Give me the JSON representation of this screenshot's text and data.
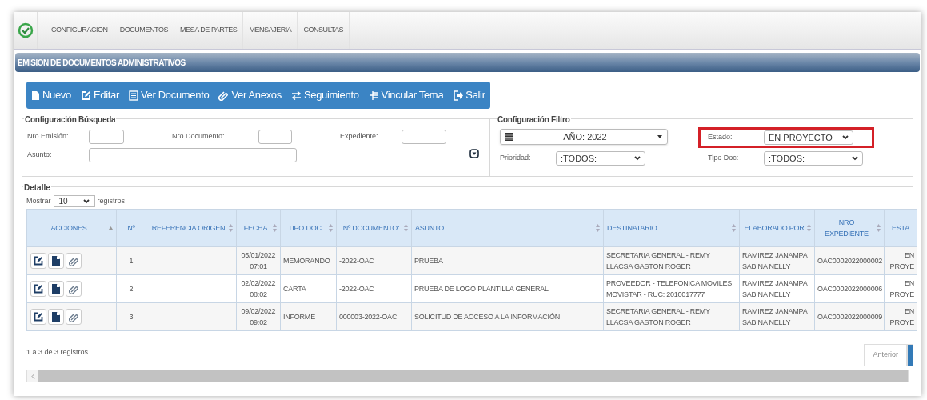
{
  "menu": [
    {
      "label": "CONFIGURACIÓN"
    },
    {
      "label": "DOCUMENTOS"
    },
    {
      "label": "MESA DE PARTES"
    },
    {
      "label": "MENSAJERÍA"
    },
    {
      "label": "CONSULTAS"
    }
  ],
  "panel_title": "EMISION DE DOCUMENTOS ADMINISTRATIVOS",
  "toolbar": [
    {
      "label": "Nuevo"
    },
    {
      "label": "Editar"
    },
    {
      "label": "Ver Documento"
    },
    {
      "label": "Ver Anexos"
    },
    {
      "label": "Seguimiento"
    },
    {
      "label": "Vincular Tema"
    },
    {
      "label": "Salir"
    }
  ],
  "search": {
    "legend": "Configuración Búsqueda",
    "fields": [
      {
        "label": "Nro Emisión:"
      },
      {
        "label": "Nro Documento:"
      },
      {
        "label": "Expediente:"
      },
      {
        "label": "Asunto:"
      }
    ]
  },
  "filter": {
    "legend": "Configuración Filtro",
    "year": "AÑO: 2022",
    "fields": [
      {
        "label": "Estado:",
        "value": "EN PROYECTO",
        "highlighted": true
      },
      {
        "label": "Prioridad:",
        "value": ":TODOS:",
        "highlighted": false
      },
      {
        "label": "Tipo Doc:",
        "value": ":TODOS:",
        "highlighted": false
      }
    ]
  },
  "detail": {
    "legend": "Detalle",
    "show_label": "Mostrar",
    "page_size": "10",
    "records_label": "registros"
  },
  "table": {
    "columns": [
      {
        "label": "ACCIONES",
        "sorted": true
      },
      {
        "label": "Nº",
        "sortable": false
      },
      {
        "label": "REFERENCIA ORIGEN",
        "sortable": true,
        "sorted": false
      },
      {
        "label": "FECHA",
        "sortable": true,
        "sorted": false
      },
      {
        "label": "TIPO DOC.",
        "sortable": true,
        "sorted": false
      },
      {
        "label": "Nº DOCUMENTO:",
        "sortable": true,
        "sorted": false
      },
      {
        "label": "ASUNTO",
        "sortable": true,
        "sorted": false
      },
      {
        "label": "DESTINATARIO",
        "sortable": true,
        "sorted": false
      },
      {
        "label": "ELABORADO POR",
        "sortable": true,
        "sorted": false
      },
      {
        "label": "NRO EXPEDIENTE",
        "sortable": true,
        "sorted": false
      },
      {
        "label": "ESTA",
        "sortable": false
      }
    ],
    "rows": [
      {
        "n": "1",
        "fecha": "05/01/2022 07:01",
        "tipo": "MEMORANDO",
        "documento": "-2022-OAC",
        "asunto": "PRUEBA",
        "destinatario": "SECRETARIA GENERAL - REMY LLACSA GASTON ROGER",
        "elaborado": "RAMIREZ JANAMPA SABINA NELLY",
        "expediente": "OAC0002022000002",
        "estado": "EN PROYE"
      },
      {
        "n": "2",
        "fecha": "02/02/2022 08:02",
        "tipo": "CARTA",
        "documento": "-2022-OAC",
        "asunto": "PRUEBA DE LOGO PLANTILLA GENERAL",
        "destinatario": "PROVEEDOR - TELEFONICA MOVILES MOVISTAR - RUC: 2010017777",
        "elaborado": "RAMIREZ JANAMPA SABINA NELLY",
        "expediente": "OAC0002022000006",
        "estado": "EN PROYE"
      },
      {
        "n": "3",
        "fecha": "09/02/2022 09:02",
        "tipo": "INFORME",
        "documento": "000003-2022-OAC",
        "asunto": "SOLICITUD DE ACCESO A LA INFORMACIÓN",
        "destinatario": "SECRETARIA GENERAL - REMY LLACSA GASTON ROGER",
        "elaborado": "RAMIREZ JANAMPA SABINA NELLY",
        "expediente": "OAC0002022000009",
        "estado": "EN PROYE"
      }
    ]
  },
  "summary": "1 a 3 de 3 registros",
  "pagination": [
    {
      "label": "Anterior",
      "selected": false
    },
    {
      "selected": true
    }
  ]
}
